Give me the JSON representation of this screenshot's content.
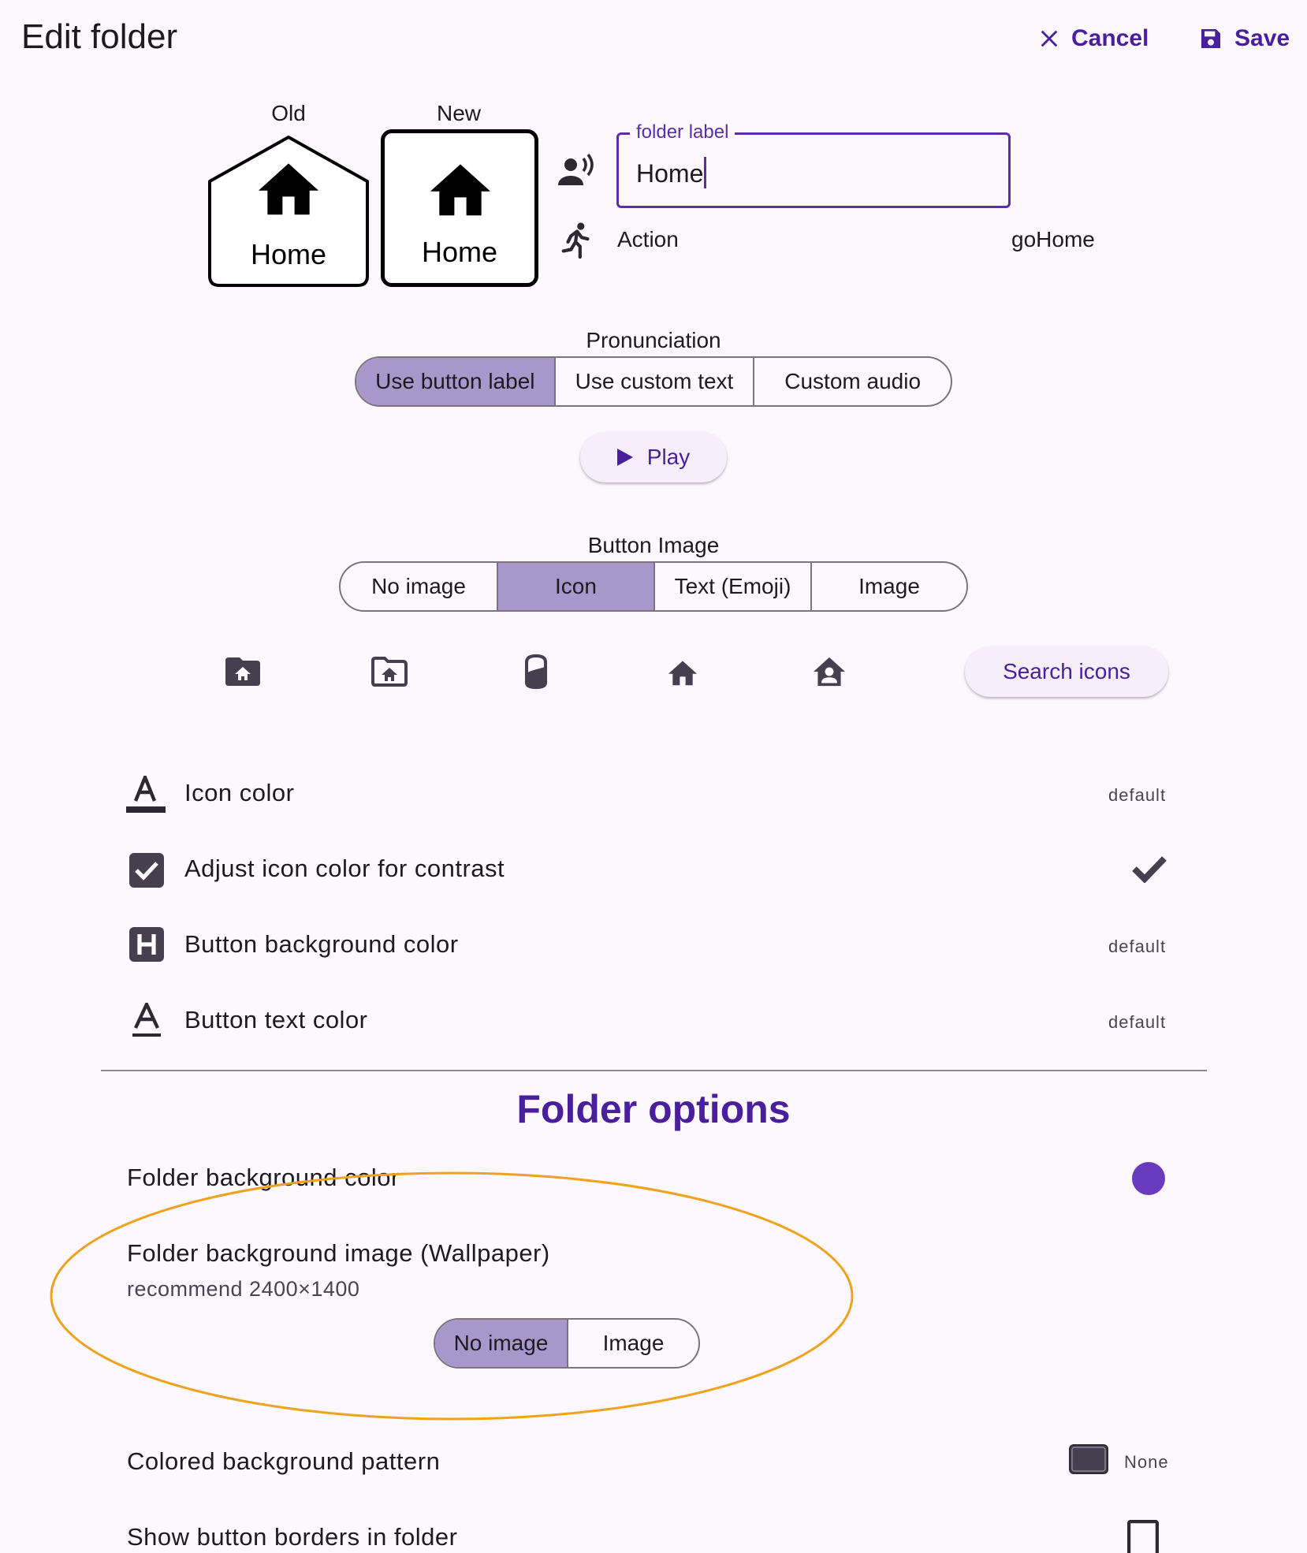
{
  "header": {
    "title": "Edit folder",
    "cancel_label": "Cancel",
    "save_label": "Save"
  },
  "preview": {
    "old_caption": "Old",
    "new_caption": "New",
    "old_label": "Home",
    "new_label": "Home"
  },
  "label_field": {
    "label": "folder label",
    "value": "Home"
  },
  "action": {
    "label": "Action",
    "value": "goHome"
  },
  "pronunciation": {
    "title": "Pronunciation",
    "options": [
      "Use button label",
      "Use custom text",
      "Custom audio"
    ],
    "selected": "Use button label",
    "play_label": "Play"
  },
  "button_image": {
    "title": "Button Image",
    "options": [
      "No image",
      "Icon",
      "Text (Emoji)",
      "Image"
    ],
    "selected": "Icon",
    "icons": [
      "folder-home-icon",
      "folder-home-outline-icon",
      "cylinder-icon",
      "home-icon",
      "home-account-icon"
    ],
    "search_label": "Search icons"
  },
  "settings": {
    "icon_color": {
      "label": "Icon color",
      "value": "default"
    },
    "adjust_contrast": {
      "label": "Adjust icon color for contrast",
      "checked": true
    },
    "bg_color": {
      "label": "Button background color",
      "value": "default"
    },
    "text_color": {
      "label": "Button text color",
      "value": "default"
    }
  },
  "folder_options": {
    "title": "Folder options",
    "bg_color": {
      "label": "Folder background color",
      "swatch": "#6a3bbd"
    },
    "bg_image": {
      "label": "Folder background image (Wallpaper)",
      "hint": "recommend 2400×1400",
      "options": [
        "No image",
        "Image"
      ],
      "selected": "No image"
    },
    "pattern": {
      "label": "Colored background pattern",
      "value": "None"
    },
    "borders": {
      "label": "Show button borders in folder",
      "checked": false
    }
  },
  "colors": {
    "accent": "#4a1f9e",
    "segment_selected": "#a897cb",
    "highlight_ellipse": "#f0a21f",
    "background": "#fdf8fd"
  }
}
